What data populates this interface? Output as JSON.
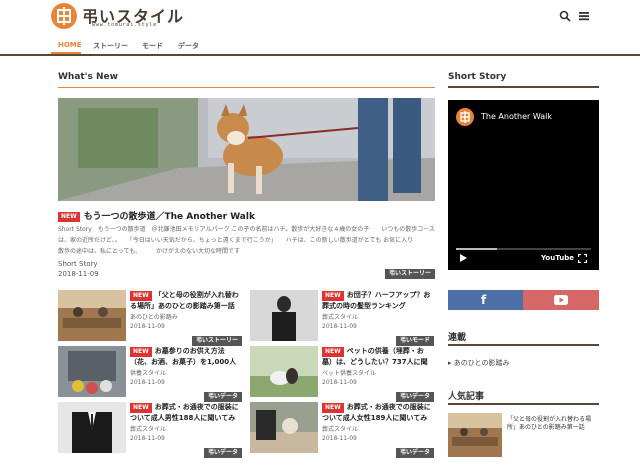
{
  "header": {
    "logo_text": "弔いスタイル",
    "logo_sub": "www.tomurai.style"
  },
  "nav": {
    "items": [
      {
        "label": "HOME",
        "active": true
      },
      {
        "label": "ストーリー",
        "active": false
      },
      {
        "label": "モード",
        "active": false
      },
      {
        "label": "データ",
        "active": false
      }
    ]
  },
  "main": {
    "section_title": "What's New",
    "new_label": "NEW",
    "hero": {
      "title": "もう一つの散歩道／The Another Walk",
      "excerpt": "Short Story　もう一つの散歩道　＠北鎌池田メモリアルパーク この子の名前はハチ。散歩が大好きな４歳の女の子　　いつもの散歩コース は、家の近所だけど、。　　「今日はいい天気だから、ちょっと遠くまで行こうか」　　ハチは、この新しい散歩道がとても お気に入り　　　　　　　　　　　　　　　　　　散歩の途中は、私にとっても、　　　かけがえのない大切な時間です",
      "category": "Short Story",
      "date": "2018-11-09",
      "badge": "弔いストーリー"
    },
    "cards": [
      {
        "title": "「父と母の役割が入れ替わる場所」あのひとの影踏み第一話",
        "category": "あのひとの影踏み",
        "date": "2018-11-09",
        "badge": "弔いストーリー"
      },
      {
        "title": "お団子？ハーフアップ？お葬式の時の髪型ランキング",
        "category": "葬式スタイル",
        "date": "2018-11-09",
        "badge": "弔いモード"
      },
      {
        "title": "お墓参りのお供え方法（花、お酒、お菓子）を1,000人に聞いてみた",
        "category": "供養スタイル",
        "date": "2018-11-09",
        "badge": "弔いデータ"
      },
      {
        "title": "ペットの供養（埋葬・お墓）は、どうしたい？737人に聞いてみた",
        "category": "ペット供養スタイル",
        "date": "2018-11-09",
        "badge": "弔いデータ"
      },
      {
        "title": "お葬式・お通夜での服装について成人男性188人に聞いてみた",
        "category": "葬式スタイル",
        "date": "2018-11-09",
        "badge": "弔いデータ"
      },
      {
        "title": "お葬式・お通夜での服装について成人女性189人に聞いてみた",
        "category": "葬式スタイル",
        "date": "2018-11-09",
        "badge": "弔いデータ"
      }
    ]
  },
  "sidebar": {
    "short_story_title": "Short Story",
    "video": {
      "title": "The Another Walk",
      "provider": "YouTube",
      "progress": 0.3
    },
    "social": {
      "facebook_icon": "f"
    },
    "series_title": "連載",
    "series_items": [
      "あのひとの影踏み"
    ],
    "popular_title": "人気記事",
    "popular_items": [
      {
        "title": "「父と母の役割が入れ替わる場所」あのひとの影踏み第一話"
      }
    ]
  },
  "colors": {
    "accent": "#e8833a",
    "dark": "#5b4638",
    "new_badge": "#dd3333",
    "facebook": "#4c6fa8",
    "youtube": "#d66868"
  }
}
